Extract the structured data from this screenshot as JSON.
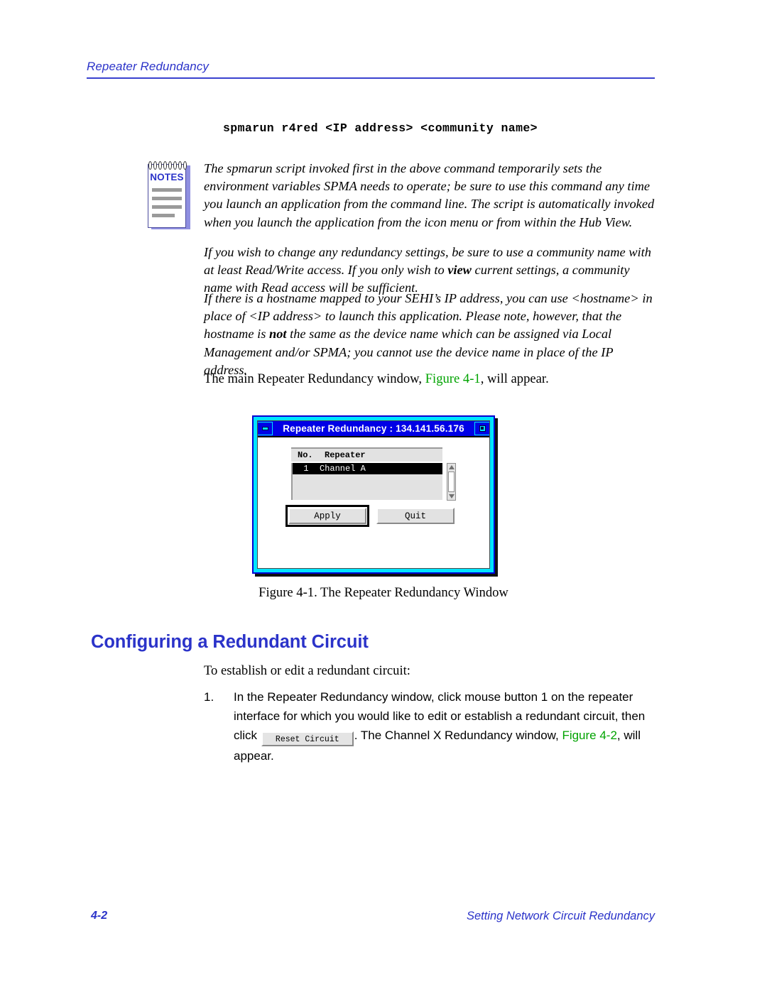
{
  "header": {
    "running_head": "Repeater Redundancy"
  },
  "command_line": "spmarun r4red <IP address> <community name>",
  "notes": {
    "icon_label": "NOTES",
    "paragraphs": [
      "The spmarun script invoked first in the above command temporarily sets the environment variables SPMA needs to operate; be sure to use this command any time you launch an application from the command line. The script is automatically invoked when you launch the application from the icon menu or from within the Hub View.",
      "If you wish to change any redundancy settings, be sure to use a community name with at least Read/Write access. If you only wish to view current settings, a community name with Read access will be sufficient."
    ],
    "emphasis_word": "view"
  },
  "body": {
    "hostname_paragraph_part1": "If there is a hostname mapped to your SEHI’s IP address, you can use <hostname> in place of <IP address> to launch this application. Please note, however, that the hostname is ",
    "hostname_emphasis": "not",
    "hostname_paragraph_part2": " the same as the device name which can be assigned via Local Management and/or SPMA; you cannot use the device name in place of the IP address.",
    "main_window_part1": "The main Repeater Redundancy window, ",
    "main_window_xref": "Figure 4-1",
    "main_window_part2": ", will appear."
  },
  "figure": {
    "window": {
      "title": "Repeater Redundancy : 134.141.56.176",
      "minimize_icon": "minimize-icon",
      "maximize_icon": "maximize-icon",
      "list": {
        "columns": [
          "No.",
          "Repeater"
        ],
        "rows": [
          {
            "no": "1",
            "repeater": "Channel A",
            "selected": true
          }
        ]
      },
      "scrollbar": {
        "up_icon": "scroll-up-arrow-icon",
        "down_icon": "scroll-down-arrow-icon"
      },
      "buttons": {
        "apply": "Apply",
        "quit": "Quit"
      }
    },
    "caption": "Figure 4-1.  The Repeater Redundancy Window"
  },
  "section": {
    "heading": "Configuring a Redundant Circuit",
    "intro": "To establish or edit a redundant circuit:",
    "steps": [
      {
        "number": "1.",
        "text_part1": "In the Repeater Redundancy window, click mouse button 1 on the repeater interface for which you would like to edit or establish a redundant circuit, then click ",
        "inline_button": "Reset Circuit",
        "text_part2": ". The Channel X Redundancy window, ",
        "xref": "Figure 4-2",
        "text_part3": ", will appear."
      }
    ]
  },
  "footer": {
    "page_number": "4-2",
    "chapter_title": "Setting Network Circuit Redundancy"
  },
  "colors": {
    "accent_blue": "#2b33c9",
    "xref_green": "#00a300",
    "titlebar_blue": "#0000e6",
    "window_border_cyan": "#00e5ff"
  }
}
